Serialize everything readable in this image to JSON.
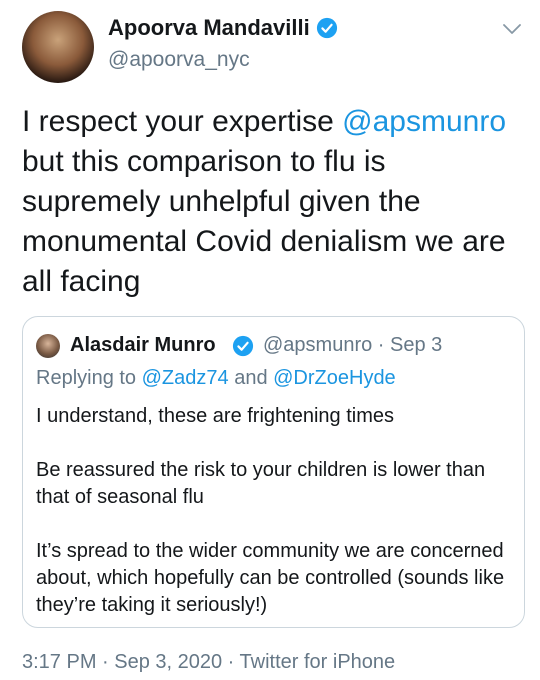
{
  "author": {
    "name": "Apoorva Mandavilli",
    "handle": "@apoorva_nyc"
  },
  "tweet": {
    "text_before": "I respect your expertise ",
    "mention": "@apsmunro",
    "text_after": " but this comparison to flu is supremely unhelpful given the monumental Covid denialism we are all facing"
  },
  "quoted": {
    "name": "Alasdair Munro",
    "handle_date": "@apsmunro · Sep 3",
    "replying_prefix": "Replying to ",
    "reply_to_1": "@Zadz74",
    "reply_and": " and ",
    "reply_to_2": "@DrZoeHyde",
    "paragraphs": [
      "I understand, these are frightening times",
      "Be reassured the risk to your children is lower than that of seasonal flu",
      "It’s spread to the wider community we are concerned about, which hopefully can be controlled (sounds like they’re taking it seriously!)"
    ]
  },
  "footer": {
    "time_date": "3:17 PM · Sep 3, 2020 · ",
    "source": "Twitter for iPhone"
  },
  "icons": {
    "verified": "verified-badge-icon",
    "menu": "chevron-down-icon"
  },
  "colors": {
    "link": "#1b95e0",
    "secondary": "#657786",
    "verified": "#1da1f2",
    "border": "#ccd6dd"
  }
}
